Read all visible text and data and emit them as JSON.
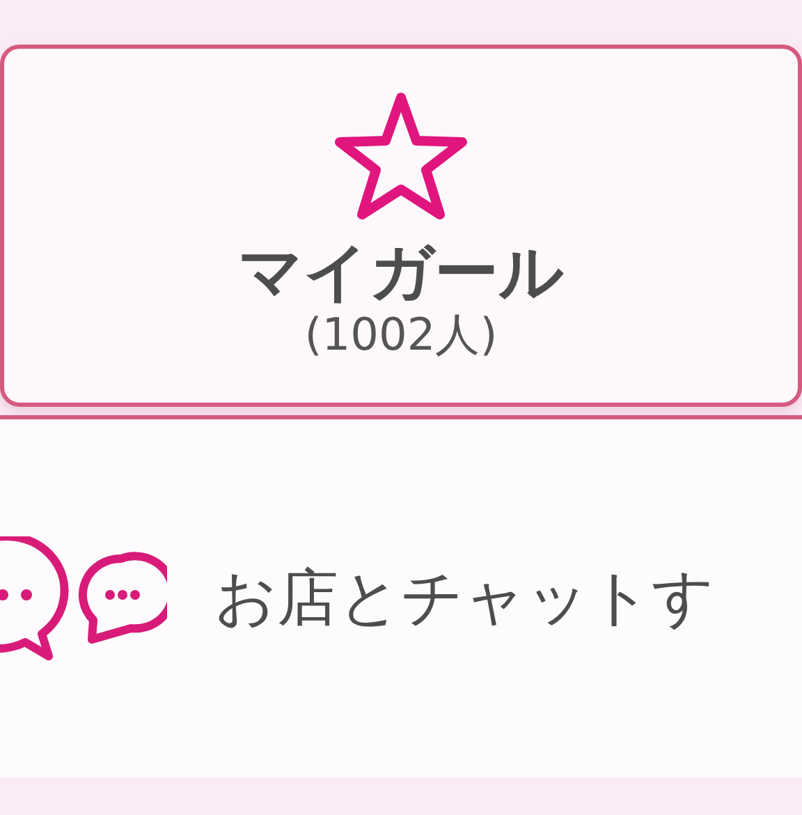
{
  "favorite_card": {
    "title": "マイガール",
    "count": "(1002人)"
  },
  "chat_button": {
    "label": "お店とチャットす"
  }
}
